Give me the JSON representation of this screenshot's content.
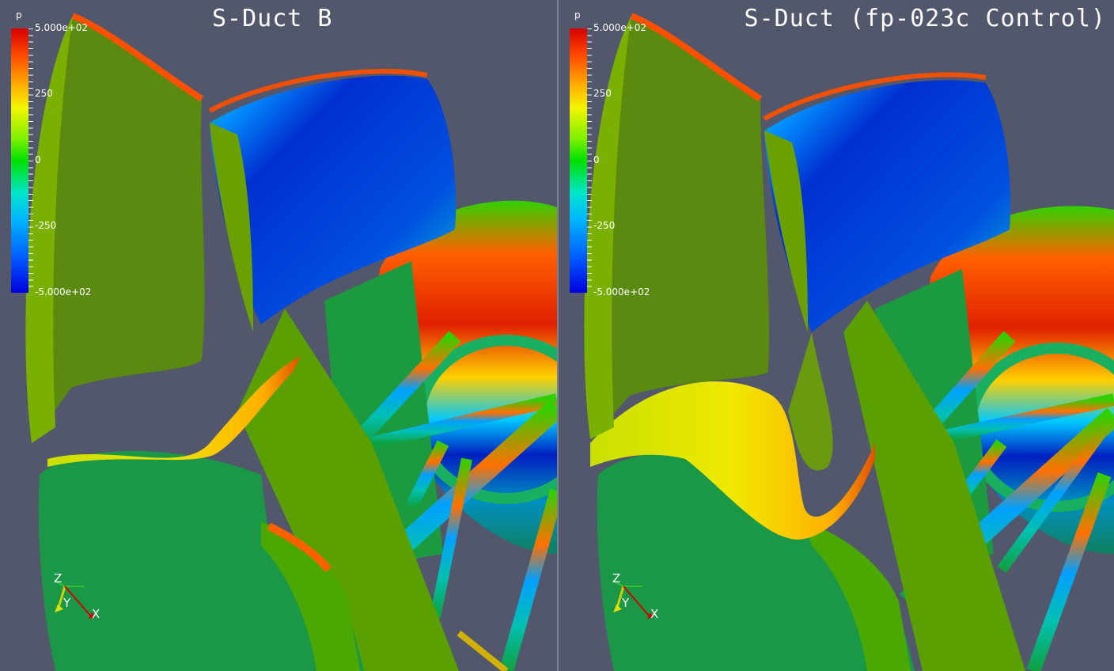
{
  "left_view": {
    "title": "S-Duct B",
    "legend": {
      "variable": "p",
      "max_label": "5.000e+02",
      "mid_high_label": "250",
      "zero_label": "0",
      "mid_low_label": "-250",
      "min_label": "-5.000e+02"
    },
    "axes": {
      "z_label": "Z",
      "y_label": "Y",
      "x_label": "X"
    }
  },
  "right_view": {
    "title": "S-Duct (fp-023c Control)",
    "legend": {
      "variable": "p",
      "max_label": "5.000e+02",
      "mid_high_label": "250",
      "zero_label": "0",
      "mid_low_label": "-250",
      "min_label": "-5.000e+02"
    },
    "axes": {
      "z_label": "Z",
      "y_label": "Y",
      "x_label": "X"
    }
  },
  "colors": {
    "background": "#52576b",
    "high": "#d40000",
    "mid": "#00e000",
    "low": "#0000e0"
  }
}
